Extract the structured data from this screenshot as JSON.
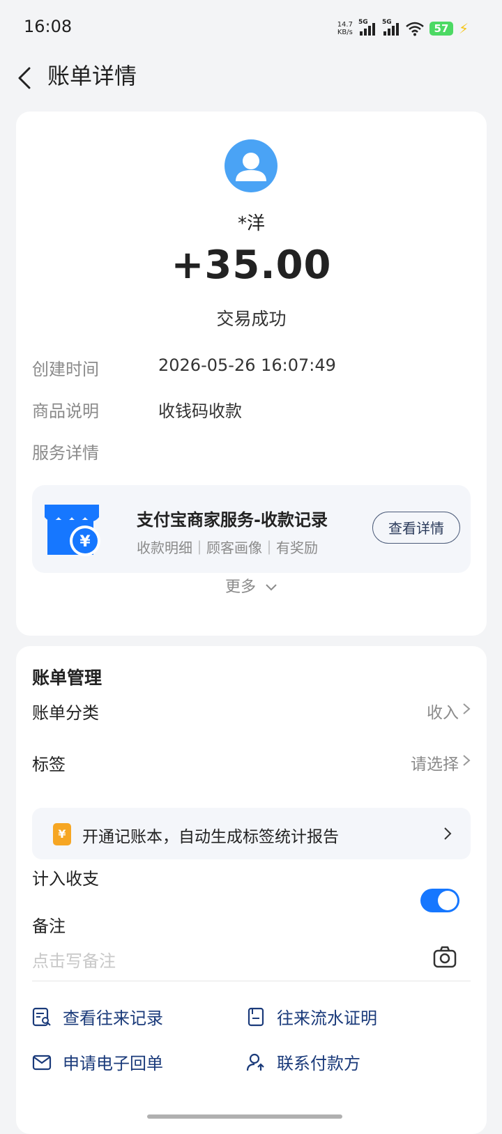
{
  "status_bar": {
    "time": "16:08",
    "net_speed_value": "14.7",
    "net_speed_unit": "KB/s",
    "signal1_label": "5G",
    "signal2_label": "5G",
    "battery": "57"
  },
  "nav": {
    "title": "账单详情"
  },
  "transaction": {
    "payer": "*洋",
    "amount": "+35.00",
    "status": "交易成功"
  },
  "details": {
    "create_time_label": "创建时间",
    "create_time_value": "2026-05-26 16:07:49",
    "product_label": "商品说明",
    "product_value": "收钱码收款",
    "service_label": "服务详情"
  },
  "service_card": {
    "title": "支付宝商家服务-收款记录",
    "subtitle": "收款明细｜顾客画像｜有奖励",
    "button_label": "查看详情"
  },
  "more_label": "更多",
  "management": {
    "title": "账单管理",
    "category_label": "账单分类",
    "category_value": "收入",
    "tag_label": "标签",
    "tag_value": "请选择",
    "promo_text": "开通记账本，自动生成标签统计报告",
    "promo_icon_char": "¥",
    "include_label": "计入收支",
    "include_enabled": true,
    "note_label": "备注",
    "note_placeholder": "点击写备注"
  },
  "actions": {
    "view_history": "查看往来记录",
    "flow_certificate": "往来流水证明",
    "e_receipt": "申请电子回单",
    "contact_payer": "联系付款方"
  },
  "colors": {
    "accent": "#1677ff",
    "avatar_bg": "#4aa3f5",
    "link": "#1a3a7a",
    "promo_icon": "#f6a623"
  }
}
